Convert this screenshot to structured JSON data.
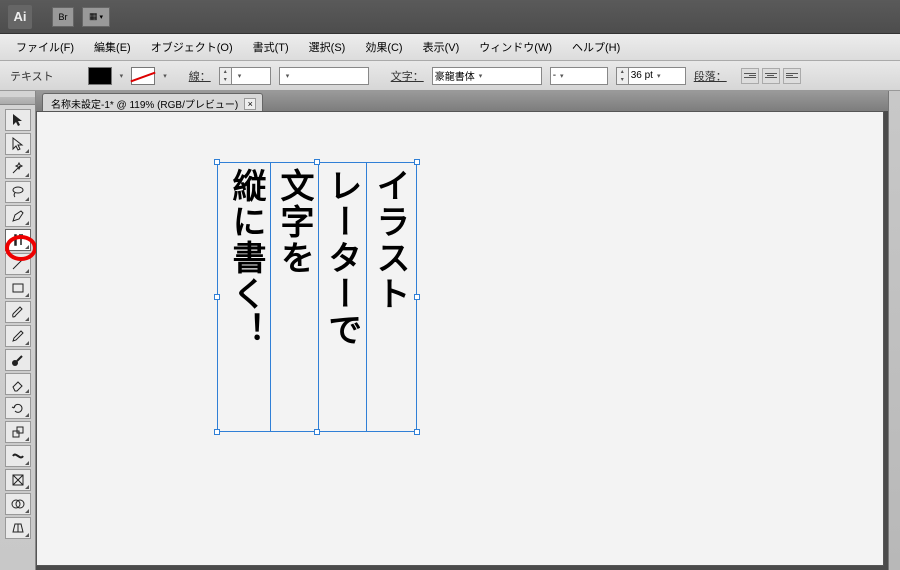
{
  "app_logo": "Ai",
  "title_buttons": {
    "br": "Br",
    "layout": "▦"
  },
  "menu": [
    "ファイル(F)",
    "編集(E)",
    "オブジェクト(O)",
    "書式(T)",
    "選択(S)",
    "効果(C)",
    "表示(V)",
    "ウィンドウ(W)",
    "ヘルプ(H)"
  ],
  "optbar": {
    "context": "テキスト",
    "stroke_label": "線：",
    "stroke_width": "",
    "char_label": "文字：",
    "font_name": "豪龍書体",
    "font_style": "-",
    "font_size": "36 pt",
    "para_label": "段落："
  },
  "doc_tab": "名称未設定-1* @ 119% (RGB/プレビュー)",
  "canvas_text": {
    "col1": "イラスト",
    "col2": "レーターで",
    "col3": "文字を",
    "col4": "縦に書く！"
  },
  "tools": [
    {
      "name": "selection-tool",
      "glyph": "sel",
      "tri": false
    },
    {
      "name": "direct-selection-tool",
      "glyph": "dsel",
      "tri": true
    },
    {
      "name": "magic-wand-tool",
      "glyph": "wand",
      "tri": true
    },
    {
      "name": "lasso-tool",
      "glyph": "lasso",
      "tri": true
    },
    {
      "name": "pen-tool",
      "glyph": "pen",
      "tri": true
    },
    {
      "name": "type-tool",
      "glyph": "type",
      "tri": true,
      "highlight": true
    },
    {
      "name": "line-tool",
      "glyph": "line",
      "tri": true
    },
    {
      "name": "rectangle-tool",
      "glyph": "rect",
      "tri": true
    },
    {
      "name": "paintbrush-tool",
      "glyph": "brush",
      "tri": true
    },
    {
      "name": "pencil-tool",
      "glyph": "pencil",
      "tri": true
    },
    {
      "name": "blob-brush-tool",
      "glyph": "blob",
      "tri": false
    },
    {
      "name": "eraser-tool",
      "glyph": "eraser",
      "tri": true
    },
    {
      "name": "rotate-tool",
      "glyph": "rotate",
      "tri": true
    },
    {
      "name": "scale-tool",
      "glyph": "scale",
      "tri": true
    },
    {
      "name": "width-tool",
      "glyph": "width",
      "tri": true
    },
    {
      "name": "free-transform-tool",
      "glyph": "ft",
      "tri": true
    },
    {
      "name": "shape-builder-tool",
      "glyph": "sb",
      "tri": true
    },
    {
      "name": "perspective-tool",
      "glyph": "persp",
      "tri": true
    }
  ]
}
